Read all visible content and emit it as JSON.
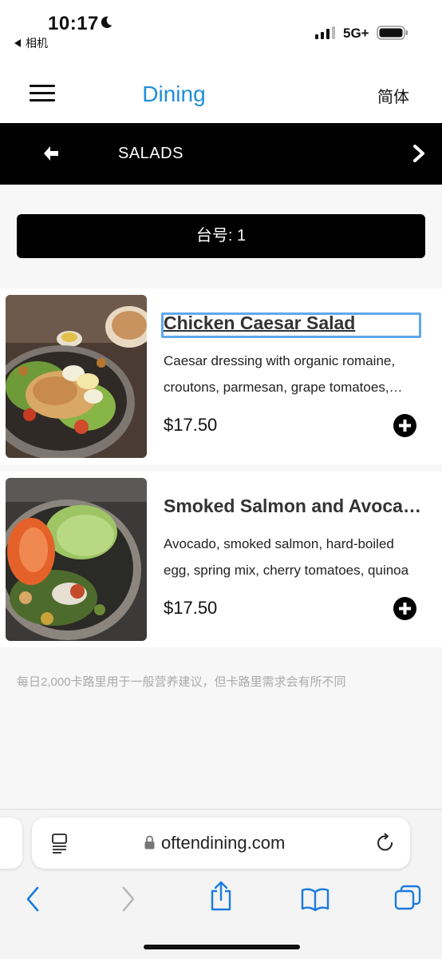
{
  "status_bar": {
    "time": "10:17",
    "back_app": "相机",
    "network": "5G+"
  },
  "header": {
    "brand": "Dining",
    "language": "简体"
  },
  "category": {
    "title": "SALADS"
  },
  "table": {
    "label": "台号: 1"
  },
  "menu_items": [
    {
      "name": "Chicken Caesar Salad",
      "description": "Caesar dressing with organic romaine, croutons, parmesan, grape tomatoes, chicken",
      "price": "$17.50"
    },
    {
      "name": "Smoked Salmon and Avocado Salad",
      "description": "Avocado, smoked salmon, hard-boiled egg, spring mix, cherry tomatoes, quinoa",
      "price": "$17.50"
    }
  ],
  "note": "每日2,000卡路里用于一般营养建议，但卡路里需求会有所不同",
  "browser": {
    "url": "oftendining.com"
  },
  "colors": {
    "brand": "#1f8fd6",
    "safari_tint": "#1a7be0",
    "focus_ring": "#5fa8ec"
  }
}
